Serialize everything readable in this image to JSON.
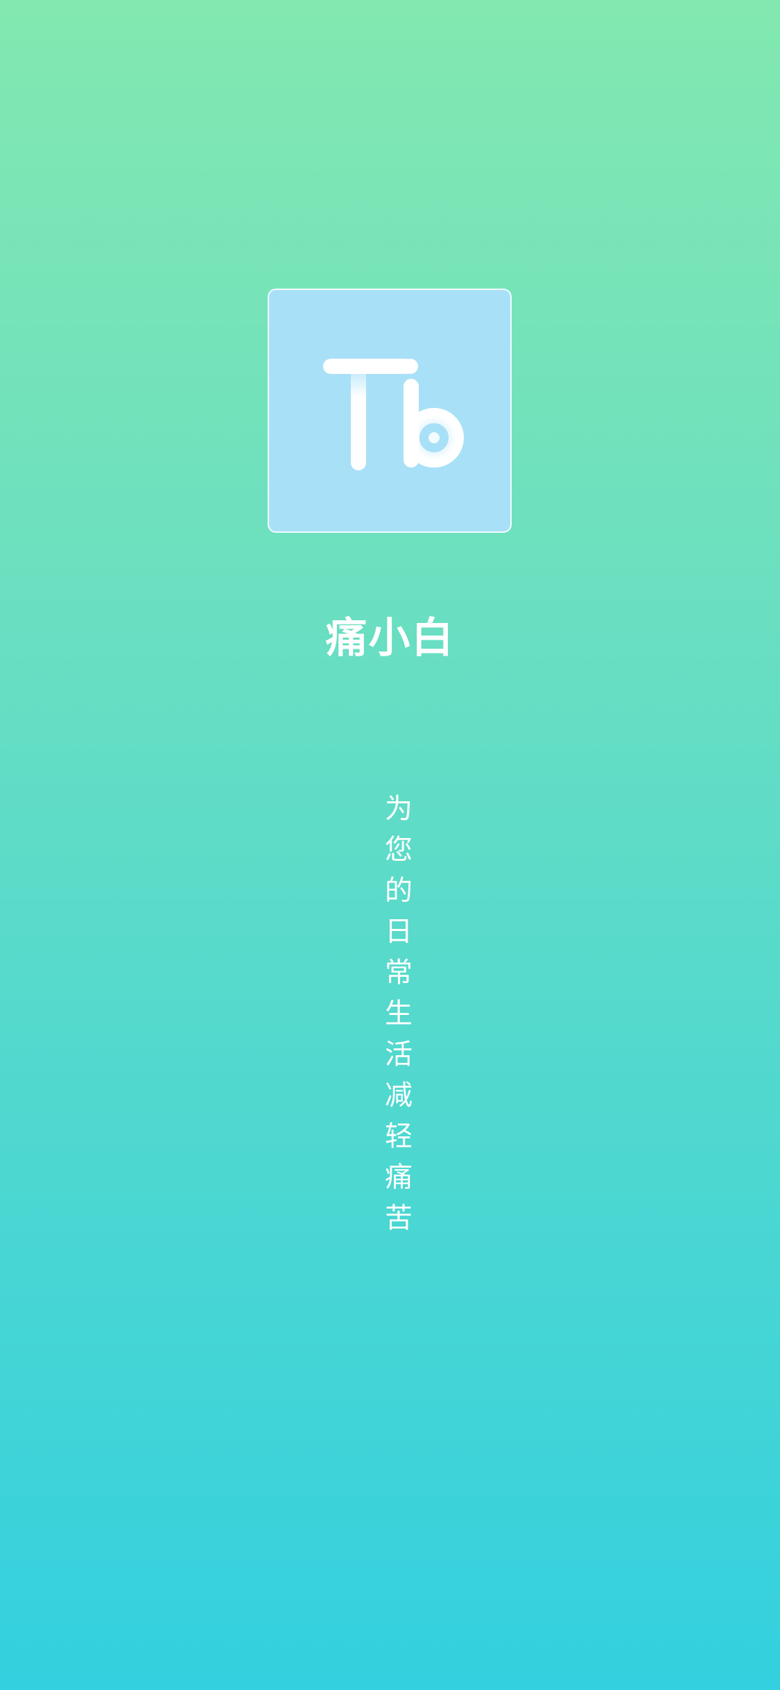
{
  "app": {
    "name": "痛小白",
    "tagline": "为您的日常生活减轻痛苦",
    "logo": {
      "icon": "tb-logo-icon",
      "card_color": "#a8e0f7"
    }
  },
  "theme": {
    "gradient_top": "#82e8b0",
    "gradient_bottom": "#33d0df",
    "text_color": "#ffffff"
  }
}
